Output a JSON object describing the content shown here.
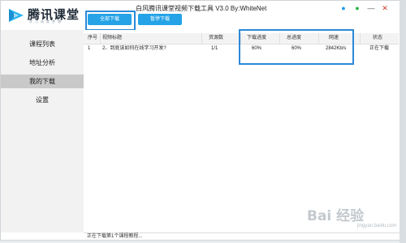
{
  "app": {
    "logo_text": "腾讯课堂",
    "logo_subtitle": "学习成就梦想",
    "title": "白风腾讯课堂视频下载工具 V3.0 By:WhiteNet"
  },
  "toolbar": {
    "download_all_label": "全部下载",
    "pause_label": "暂停下载"
  },
  "sidebar": {
    "items": [
      {
        "label": "课程列表"
      },
      {
        "label": "地址分析"
      },
      {
        "label": "我的下载"
      },
      {
        "label": "设置"
      }
    ],
    "active_index": 2
  },
  "table": {
    "headers": [
      "序号",
      "视频标题",
      "资源数",
      "下载进度",
      "总进度",
      "网速",
      "状态"
    ],
    "rows": [
      {
        "index": "1",
        "title": "2、到底该如何在线学习开发?",
        "resources": "1/1",
        "download_progress": "60%",
        "total_progress": "60%",
        "speed": "2842Kb/s",
        "status": "正在下载"
      }
    ]
  },
  "statusbar": {
    "text": "正在下载第1个课程教程..."
  },
  "watermark": {
    "text": "Bai 经验",
    "sub": "jingyan.baidu.com"
  },
  "colors": {
    "accent": "#25a3e6",
    "highlight_border": "#2b89d8",
    "sidebar_bg": "#f2f2f2",
    "sidebar_active": "#c9c9c9"
  }
}
